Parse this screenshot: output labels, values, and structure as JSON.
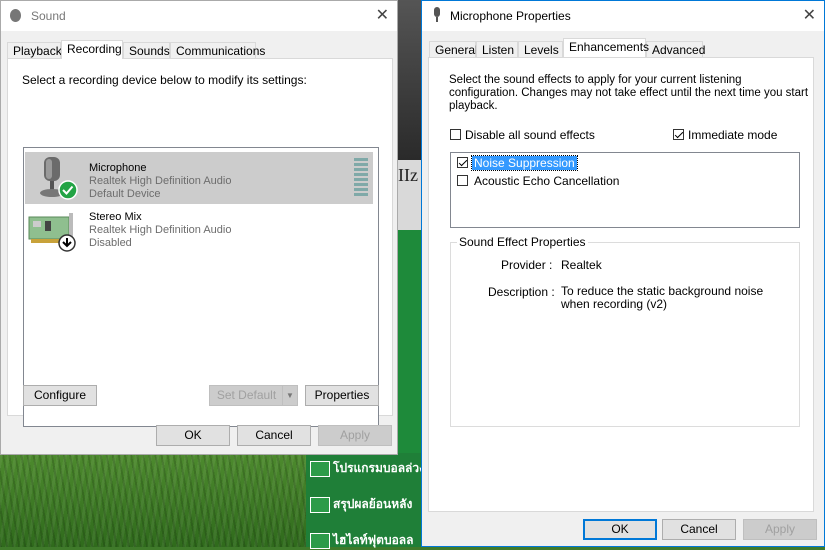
{
  "sound": {
    "title": "Sound",
    "tabs": [
      "Playback",
      "Recording",
      "Sounds",
      "Communications"
    ],
    "active_tab": "Recording",
    "instruction": "Select a recording device below to modify its settings:",
    "devices": [
      {
        "name": "Microphone",
        "driver": "Realtek High Definition Audio",
        "status": "Default Device",
        "selected": true
      },
      {
        "name": "Stereo Mix",
        "driver": "Realtek High Definition Audio",
        "status": "Disabled",
        "selected": false
      }
    ],
    "buttons": {
      "configure": "Configure",
      "set_default": "Set Default",
      "properties": "Properties",
      "ok": "OK",
      "cancel": "Cancel",
      "apply": "Apply"
    }
  },
  "mic": {
    "title": "Microphone Properties",
    "tabs": [
      "General",
      "Listen",
      "Levels",
      "Enhancements",
      "Advanced"
    ],
    "active_tab": "Enhancements",
    "instruction": "Select the sound effects to apply for your current listening configuration. Changes may not take effect until the next time you start playback.",
    "disable_all": {
      "label": "Disable all sound effects",
      "checked": false
    },
    "immediate": {
      "label": "Immediate mode",
      "checked": true
    },
    "effects": [
      {
        "label": "Noise Suppression",
        "checked": true,
        "selected": true
      },
      {
        "label": "Acoustic Echo Cancellation",
        "checked": false,
        "selected": false
      }
    ],
    "props_group": "Sound Effect Properties",
    "provider_label": "Provider :",
    "provider_value": "Realtek",
    "description_label": "Description :",
    "description_value": "To reduce the static background noise when recording (v2)",
    "buttons": {
      "ok": "OK",
      "cancel": "Cancel",
      "apply": "Apply"
    }
  },
  "background": {
    "items": [
      "โปรแกรมบอลล่วง",
      "สรุปผลย้อนหลัง",
      "ไฮไลท์ฟุตบอลล"
    ],
    "partial": "IIz"
  },
  "colors": {
    "accent": "#0078d7",
    "selection": "#3399ff",
    "check": "#23a445"
  }
}
